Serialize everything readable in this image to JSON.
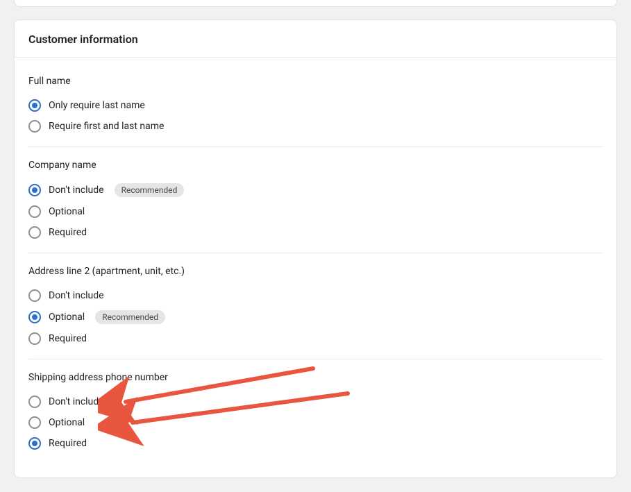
{
  "card": {
    "title": "Customer information",
    "badge_label": "Recommended",
    "sections": [
      {
        "label": "Full name",
        "options": [
          {
            "label": "Only require last name",
            "selected": true,
            "recommended": false
          },
          {
            "label": "Require first and last name",
            "selected": false,
            "recommended": false
          }
        ]
      },
      {
        "label": "Company name",
        "options": [
          {
            "label": "Don't include",
            "selected": true,
            "recommended": true
          },
          {
            "label": "Optional",
            "selected": false,
            "recommended": false
          },
          {
            "label": "Required",
            "selected": false,
            "recommended": false
          }
        ]
      },
      {
        "label": "Address line 2 (apartment, unit, etc.)",
        "options": [
          {
            "label": "Don't include",
            "selected": false,
            "recommended": false
          },
          {
            "label": "Optional",
            "selected": true,
            "recommended": true
          },
          {
            "label": "Required",
            "selected": false,
            "recommended": false
          }
        ]
      },
      {
        "label": "Shipping address phone number",
        "options": [
          {
            "label": "Don't include",
            "selected": false,
            "recommended": false
          },
          {
            "label": "Optional",
            "selected": false,
            "recommended": false
          },
          {
            "label": "Required",
            "selected": true,
            "recommended": false
          }
        ]
      }
    ]
  },
  "annotations": {
    "arrows": [
      {
        "target_option_index": 1
      },
      {
        "target_option_index": 2
      }
    ]
  }
}
